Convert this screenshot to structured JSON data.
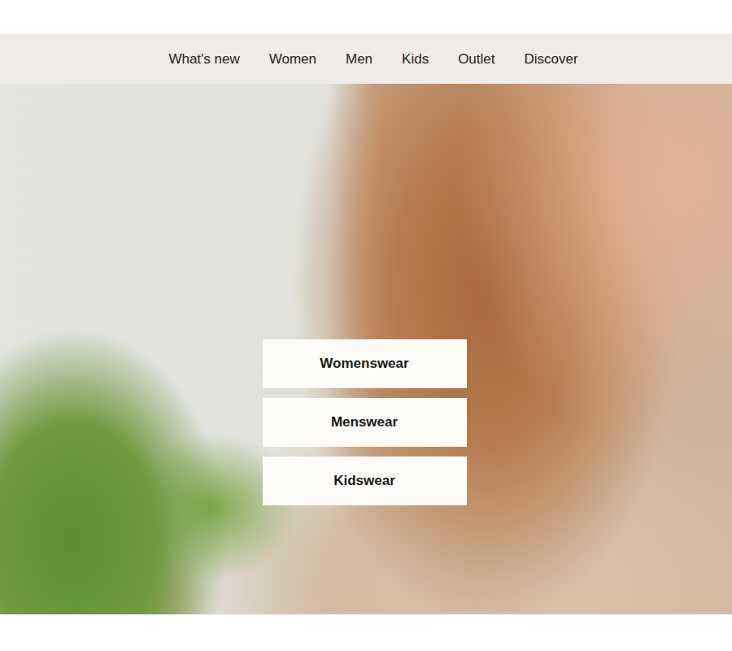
{
  "navigation": {
    "items": [
      {
        "label": "What's new"
      },
      {
        "label": "Women"
      },
      {
        "label": "Men"
      },
      {
        "label": "Kids"
      },
      {
        "label": "Outlet"
      },
      {
        "label": "Discover"
      }
    ]
  },
  "hero": {
    "buttons": [
      "Womenswear",
      "Menswear",
      "Kidswear"
    ]
  }
}
